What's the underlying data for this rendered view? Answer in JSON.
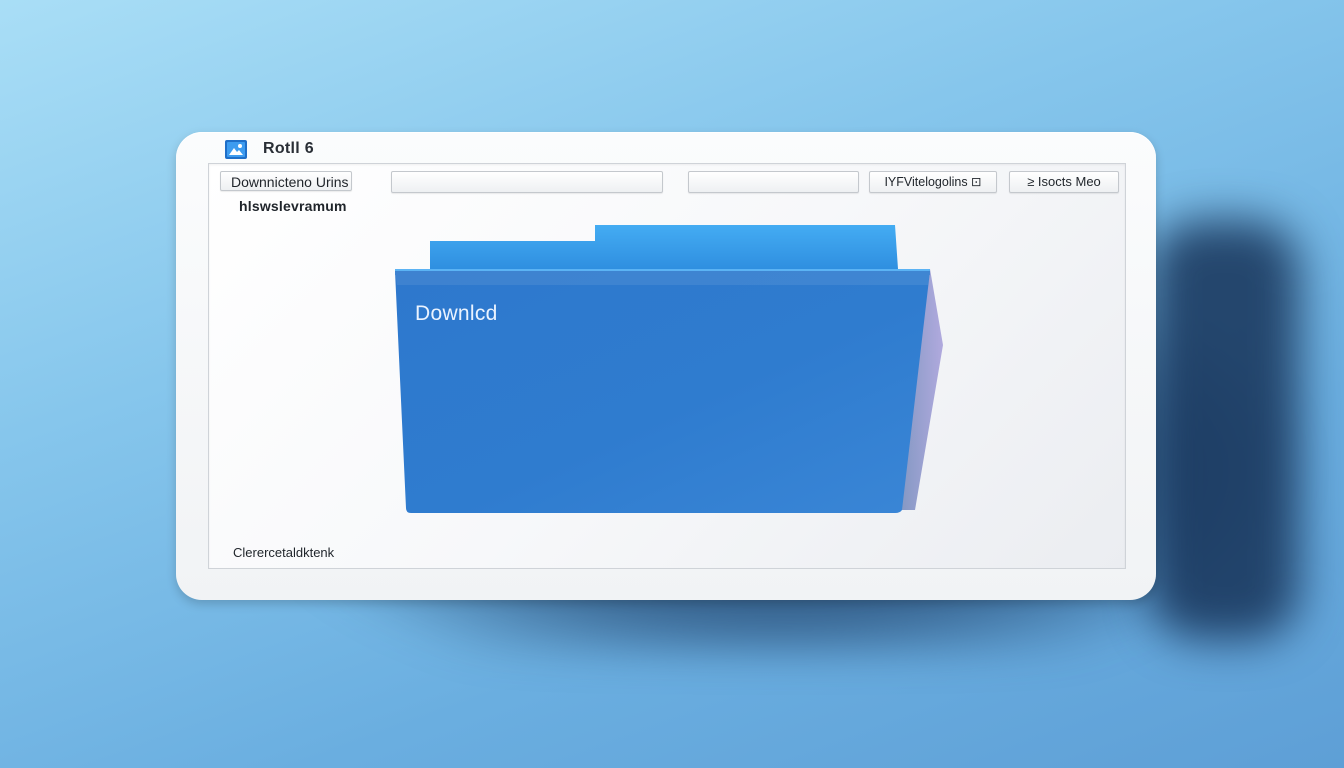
{
  "window": {
    "title": "Rotll 6",
    "icon": "app-icon"
  },
  "toolbar": {
    "downloads_button": "Downnicteno Urins",
    "blank_field_1": "",
    "blank_field_2": "",
    "right_button_1": "IYFVitelogolins ⊡",
    "right_button_2": "≥ Isocts Meo"
  },
  "content": {
    "sub_label": "hlswslevramum",
    "folder_label": "Downlcd",
    "folder_icon": "folder-icon",
    "status_text": "Clerercetaldktenk"
  },
  "colors": {
    "folder_front": "#2f7bcf",
    "folder_back": "#3aa2ee",
    "background": "#86c6ec"
  }
}
